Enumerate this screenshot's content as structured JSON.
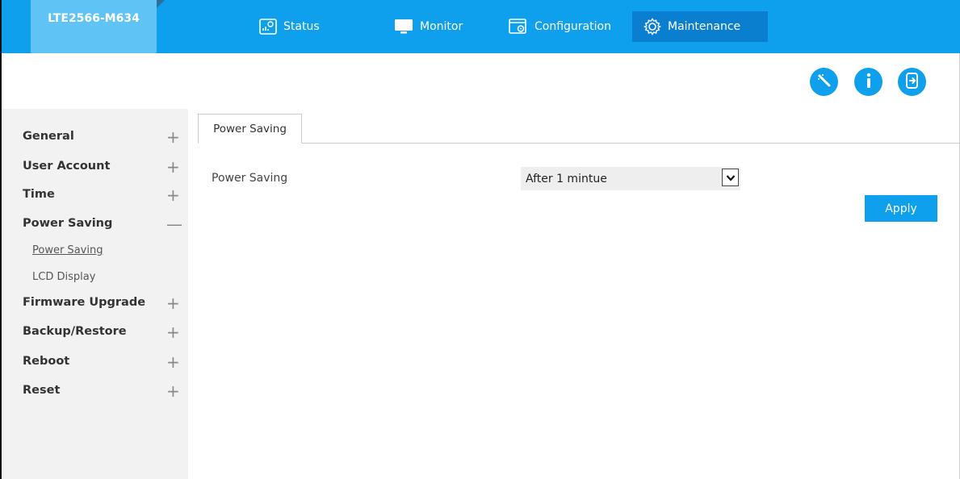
{
  "header": {
    "brand": "LTE2566-M634",
    "nav": [
      {
        "label": "Status",
        "icon": "status-icon",
        "active": false
      },
      {
        "label": "Monitor",
        "icon": "monitor-icon",
        "active": false
      },
      {
        "label": "Configuration",
        "icon": "configuration-icon",
        "active": false
      },
      {
        "label": "Maintenance",
        "icon": "gear-icon",
        "active": true
      }
    ]
  },
  "utility_icons": [
    "wizard-icon",
    "info-icon",
    "logout-icon"
  ],
  "sidebar": {
    "items": [
      {
        "label": "General",
        "sign": "+"
      },
      {
        "label": "User Account",
        "sign": "+"
      },
      {
        "label": "Time",
        "sign": "+"
      },
      {
        "label": "Power Saving",
        "sign": "—"
      },
      {
        "label": "Firmware Upgrade",
        "sign": "+"
      },
      {
        "label": "Backup/Restore",
        "sign": "+"
      },
      {
        "label": "Reboot",
        "sign": "+"
      },
      {
        "label": "Reset",
        "sign": "+"
      }
    ],
    "subitems": [
      {
        "label": "Power Saving",
        "current": true
      },
      {
        "label": "LCD Display",
        "current": false
      }
    ]
  },
  "main": {
    "tab": "Power Saving",
    "field_label": "Power Saving",
    "select_value": "After 1 mintue",
    "apply_label": "Apply"
  },
  "colors": {
    "accent": "#0fa0ed",
    "brand_bg": "#5fc4f5",
    "active_nav": "#0a7fd0",
    "sidebar_bg": "#f2f2f2"
  }
}
